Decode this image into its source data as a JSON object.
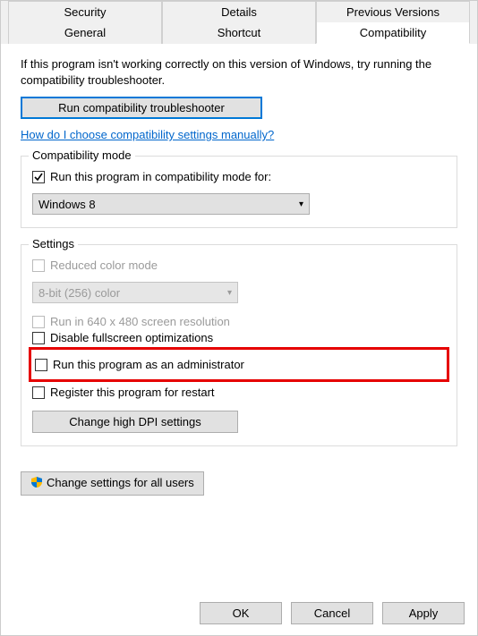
{
  "tabs_row1": [
    "Security",
    "Details",
    "Previous Versions"
  ],
  "tabs_row2": [
    "General",
    "Shortcut",
    "Compatibility"
  ],
  "active_tab": "Compatibility",
  "intro": "If this program isn't working correctly on this version of Windows, try running the compatibility troubleshooter.",
  "troubleshooter_btn": "Run compatibility troubleshooter",
  "help_link": "How do I choose compatibility settings manually?",
  "compat_group": {
    "title": "Compatibility mode",
    "checkbox_label": "Run this program in compatibility mode for:",
    "checkbox_checked": true,
    "dropdown_value": "Windows 8"
  },
  "settings_group": {
    "title": "Settings",
    "reduced_color": "Reduced color mode",
    "color_depth_value": "8-bit (256) color",
    "run_640": "Run in 640 x 480 screen resolution",
    "disable_fullscreen": "Disable fullscreen optimizations",
    "run_admin": "Run this program as an administrator",
    "register_restart": "Register this program for restart",
    "dpi_btn": "Change high DPI settings"
  },
  "all_users_btn": "Change settings for all users",
  "footer": {
    "ok": "OK",
    "cancel": "Cancel",
    "apply": "Apply"
  }
}
